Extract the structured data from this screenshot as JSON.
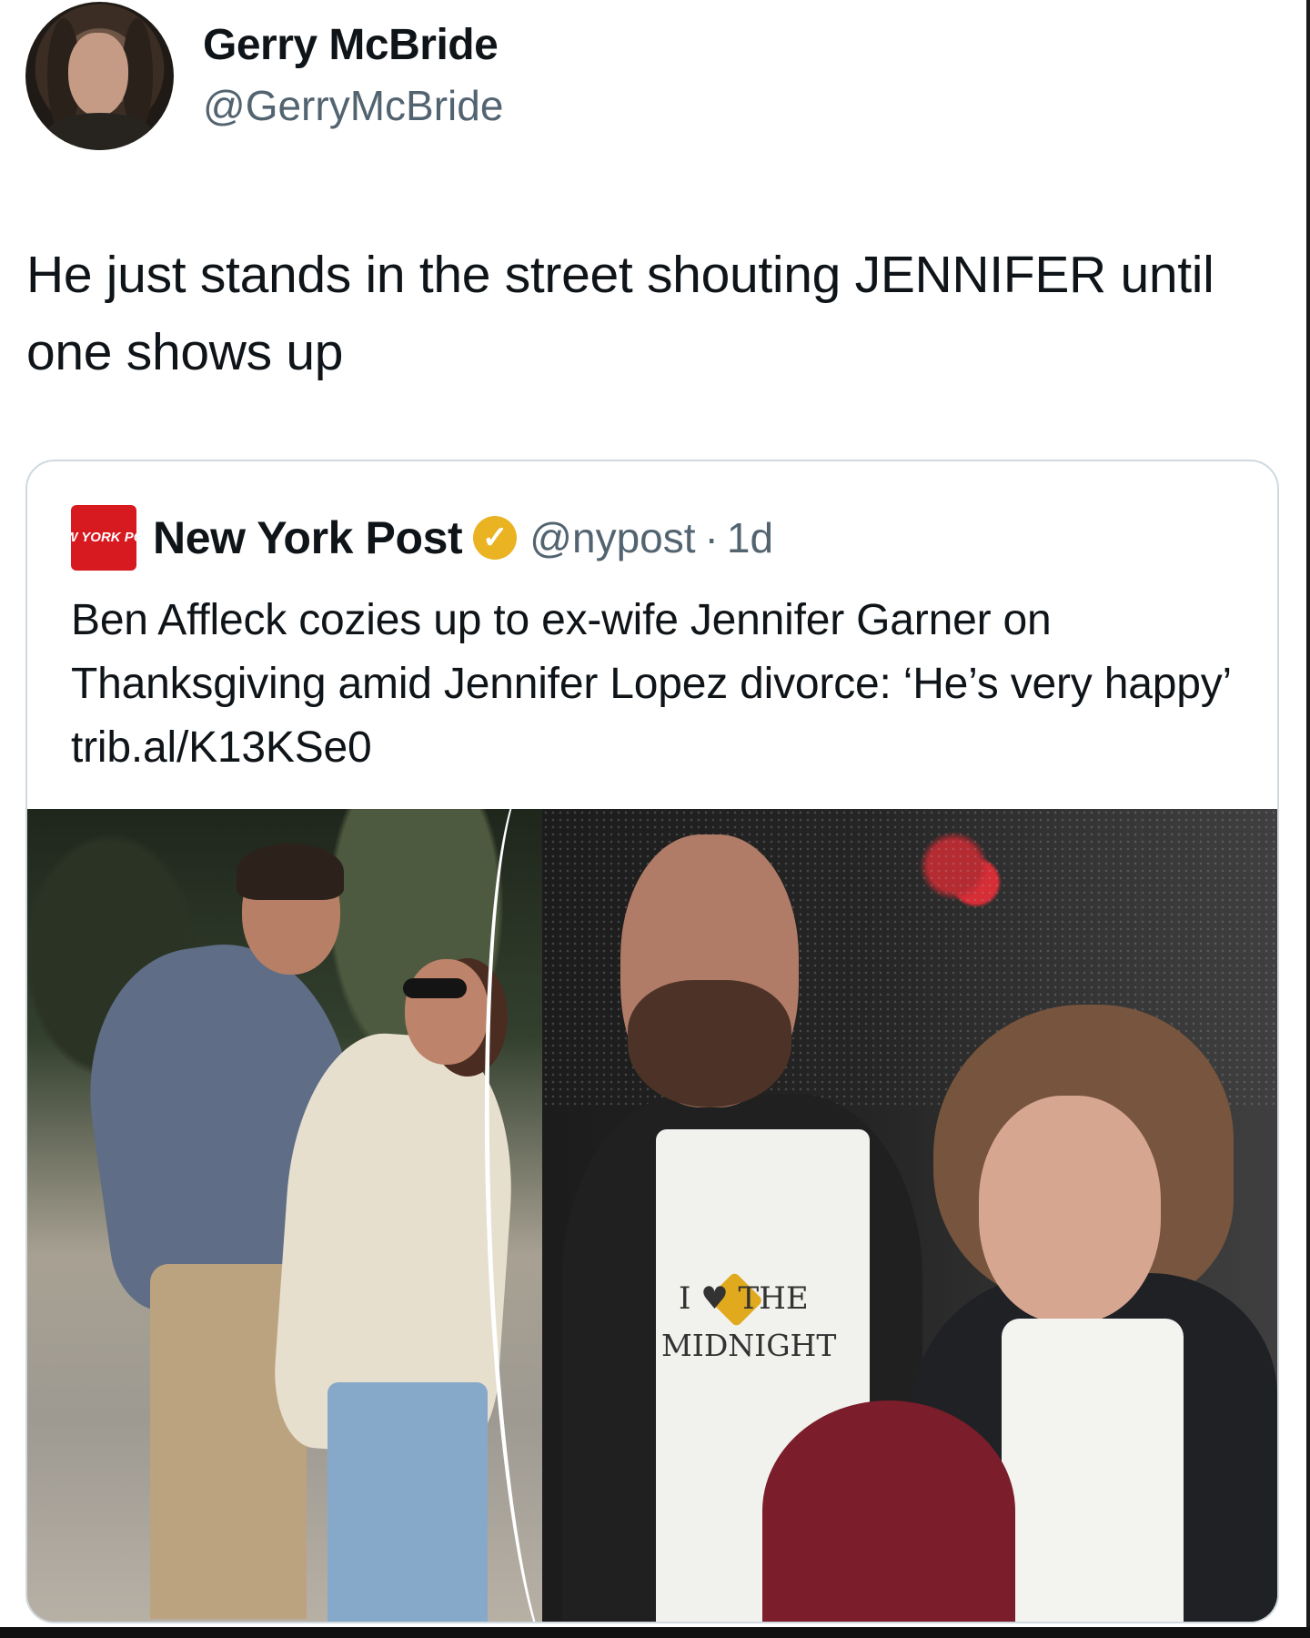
{
  "tweet": {
    "author": {
      "display_name": "Gerry McBride",
      "handle": "@GerryMcBride"
    },
    "text": "He just stands in the street shouting JENNIFER until one shows up"
  },
  "quoted_tweet": {
    "source_logo_text": "NEW YORK POST",
    "author_name": "New York Post",
    "verified_icon": "verified-badge-icon",
    "handle": "@nypost",
    "separator": "·",
    "time": "1d",
    "text": "Ben Affleck cozies up to ex-wife Jennifer Garner on Thanksgiving amid Jennifer Lopez divorce: ‘He’s very happy’ trib.al/K13KSe0",
    "image_texts": {
      "apron_line_1": "I ♥ THE",
      "apron_line_2": "MIDNIGHT"
    }
  },
  "colors": {
    "background": "#ffffff",
    "text": "#0f1419",
    "secondary_text": "#536471",
    "card_border": "#cfd9de",
    "nypost_red": "#d71920",
    "verified_gold": "#e9b321"
  }
}
